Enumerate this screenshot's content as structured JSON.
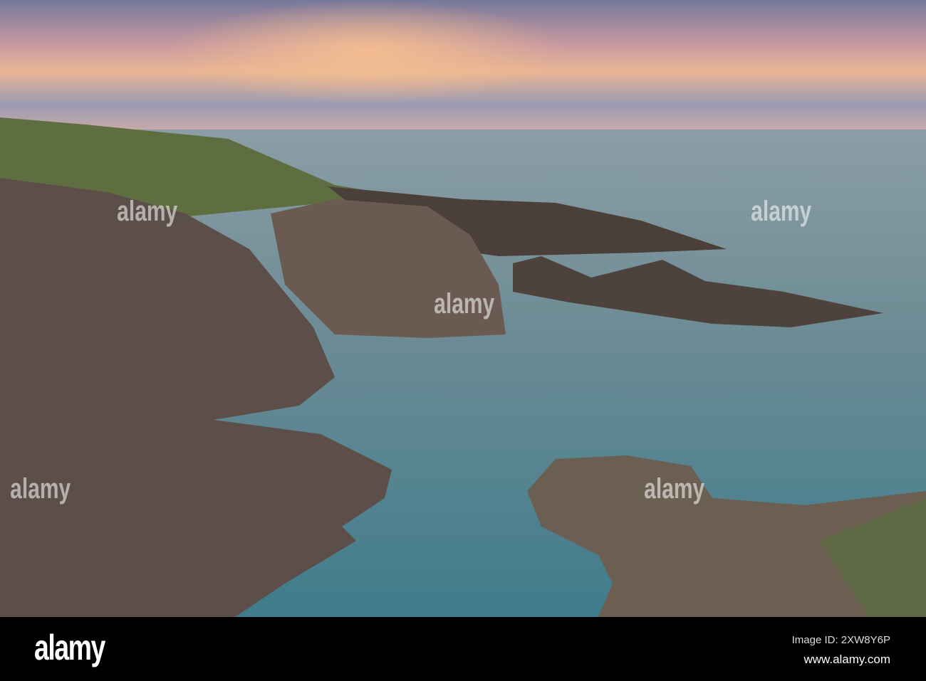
{
  "watermark": {
    "logo": "alamy",
    "image_id": "Image ID: 2XW8Y6P",
    "url": "www.alamy.com"
  },
  "colors": {
    "sky_top": "#6e7290",
    "sunset": "#f0b38a",
    "sea": "#5f8790",
    "rock": "#5a4a42",
    "grass": "#6b7a45"
  }
}
